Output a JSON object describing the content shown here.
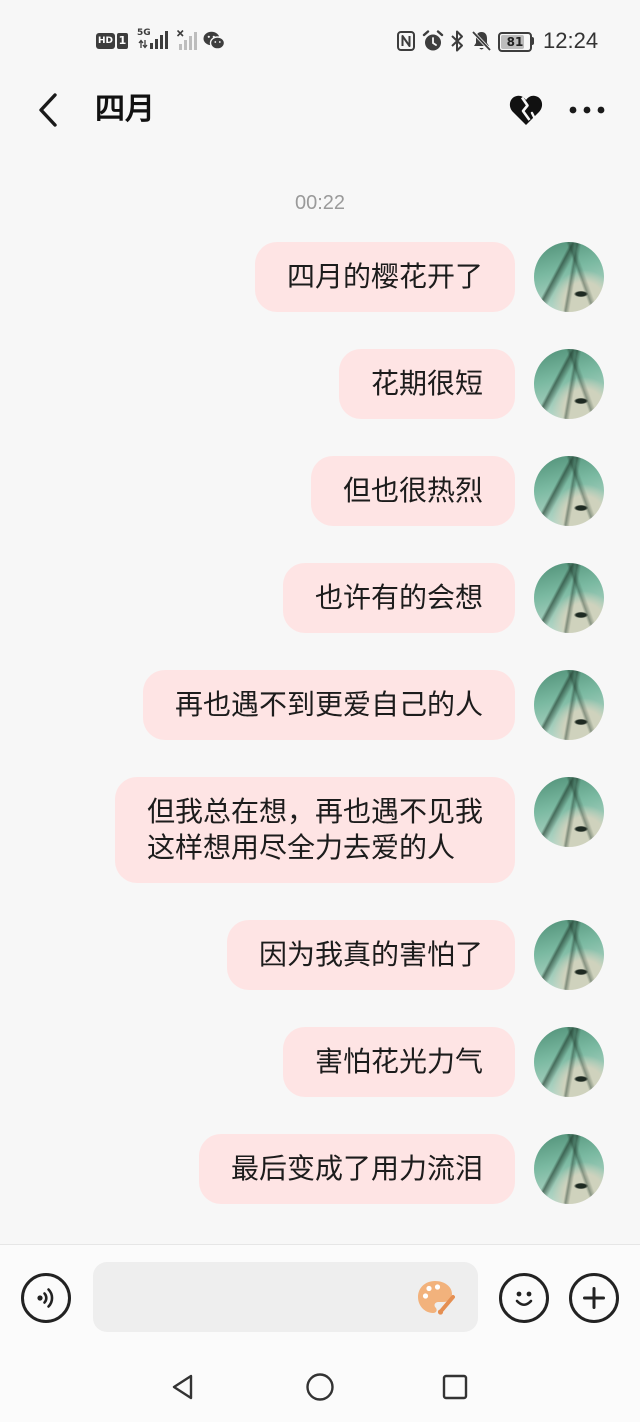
{
  "status_bar": {
    "hd_badge": "HD",
    "sim_slot": "1",
    "network_type": "5G",
    "battery_level": "81",
    "time": "12:24",
    "icons": [
      "hd-icon",
      "signal-5g-icon",
      "signal-no-service-icon",
      "wechat-icon",
      "nfc-icon",
      "alarm-icon",
      "bluetooth-icon",
      "mute-icon",
      "battery-icon"
    ]
  },
  "header": {
    "title": "四月",
    "icons": [
      "back-icon",
      "heart-icon",
      "more-icon"
    ]
  },
  "chat": {
    "timestamp": "00:22",
    "messages": [
      {
        "outgoing": true,
        "text": "四月的樱花开了"
      },
      {
        "outgoing": true,
        "text": "花期很短"
      },
      {
        "outgoing": true,
        "text": "但也很热烈"
      },
      {
        "outgoing": true,
        "text": "也许有的会想"
      },
      {
        "outgoing": true,
        "text": "再也遇不到更爱自己的人"
      },
      {
        "outgoing": true,
        "text": "但我总在想，再也遇不见我\n这样想用尽全力去爱的人"
      },
      {
        "outgoing": true,
        "text": "因为我真的害怕了"
      },
      {
        "outgoing": true,
        "text": "害怕花光力气"
      },
      {
        "outgoing": true,
        "text": "最后变成了用力流泪"
      }
    ]
  },
  "composer": {
    "value": "",
    "icons": [
      "voice-icon",
      "palette-icon",
      "emoji-icon",
      "plus-icon"
    ]
  },
  "nav_bar": {
    "icons": [
      "nav-back-icon",
      "nav-home-icon",
      "nav-recents-icon"
    ]
  },
  "colors": {
    "background": "#f7f7f7",
    "bubble_sent": "#fee4e4",
    "text": "#1c1c1c",
    "timestamp": "#9a9a9a",
    "palette_accent": "#f2b27c"
  }
}
